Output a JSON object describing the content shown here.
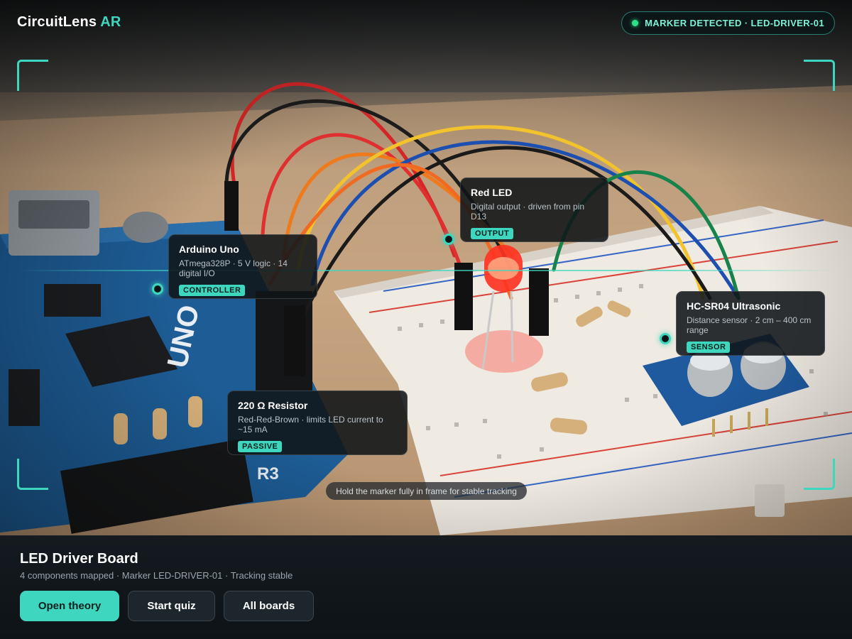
{
  "app": {
    "brand_main": "CircuitLens",
    "brand_accent": "AR"
  },
  "status": {
    "text": "MARKER DETECTED · LED-DRIVER-01",
    "color": "#2fe08a"
  },
  "annotations": {
    "led": {
      "title": "Red LED",
      "description": "Digital output · driven from pin D13",
      "tag": "OUTPUT"
    },
    "arduino": {
      "title": "Arduino Uno",
      "description": "ATmega328P · 5 V logic · 14 digital I/O",
      "tag": "CONTROLLER"
    },
    "sensor": {
      "title": "HC-SR04 Ultrasonic",
      "description": "Distance sensor · 2 cm – 400 cm range",
      "tag": "SENSOR"
    },
    "resistor": {
      "title": "220 Ω Resistor",
      "description": "Red-Red-Brown · limits LED current to ~15 mA",
      "tag": "PASSIVE"
    }
  },
  "hint": "Hold the marker fully in frame for stable tracking",
  "board": {
    "title": "LED Driver Board",
    "subtitle": "4 components mapped · Marker LED-DRIVER-01 · Tracking stable"
  },
  "actions": {
    "open_theory": "Open theory",
    "start_quiz": "Start quiz",
    "all_boards": "All boards"
  },
  "colors": {
    "accent": "#3fd6bf",
    "panel": "#141a1f",
    "card": "#101418"
  }
}
